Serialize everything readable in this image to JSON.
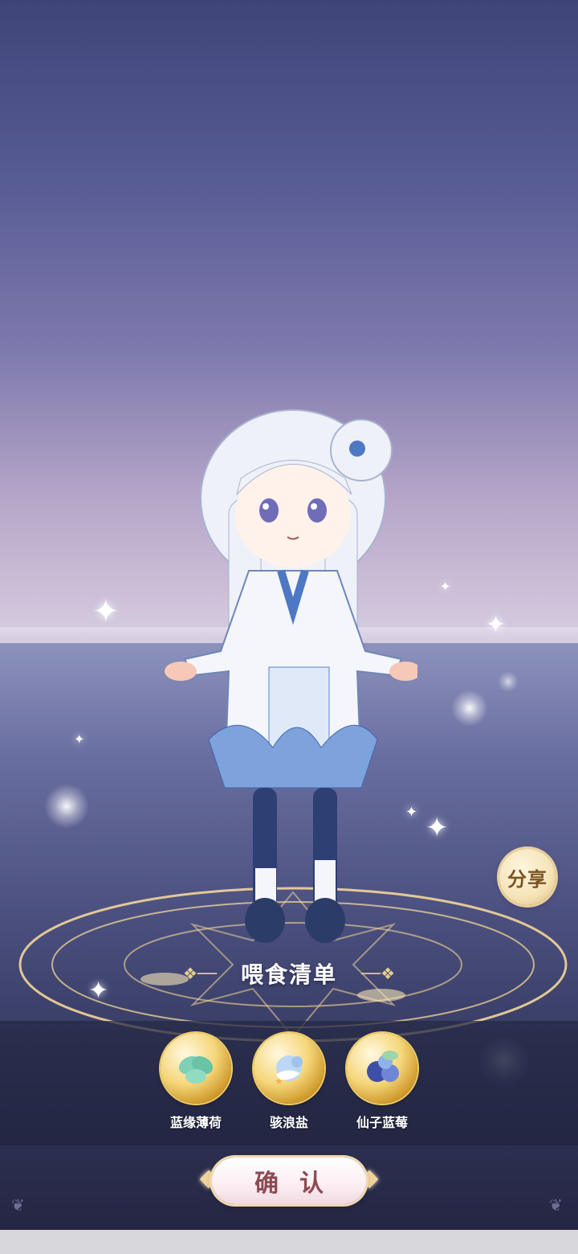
{
  "share": {
    "label": "分享"
  },
  "feed_list": {
    "title": "喂食清单",
    "items": [
      {
        "label": "蓝缘薄荷",
        "icon": "mint-leaves-icon"
      },
      {
        "label": "骇浪盐",
        "icon": "sea-salt-icon"
      },
      {
        "label": "仙子蓝莓",
        "icon": "blueberry-icon"
      }
    ]
  },
  "confirm": {
    "label": "确认"
  },
  "colors": {
    "accent_gold": "#e7cf8f",
    "button_text": "#8e4a53",
    "share_text": "#7a5324"
  }
}
